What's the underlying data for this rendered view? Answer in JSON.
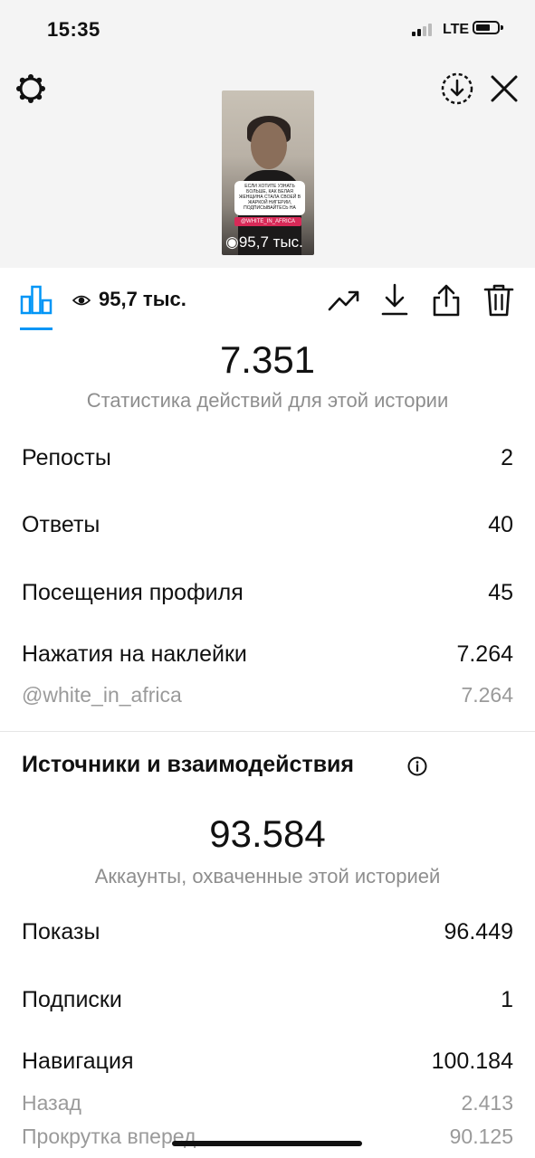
{
  "status_bar": {
    "time": "15:35",
    "network": "LTE"
  },
  "story_preview": {
    "caption": "ЕСЛИ ХОТИТЕ УЗНАТЬ БОЛЬШЕ, КАК БЕЛАЯ ЖЕНЩИНА СТАЛА СВОЕЙ В ЖАРКОЙ НИГЕРИИ, ПОДПИСЫВАЙТЕСЬ НА",
    "tag": "@WHITE_IN_AFRICA",
    "views": "95,7 тыс."
  },
  "toolbar": {
    "views": "95,7 тыс.",
    "icons": [
      "bar-chart-icon",
      "eye-icon",
      "trending-icon",
      "download-icon",
      "share-icon",
      "trash-icon"
    ]
  },
  "actions": {
    "total": "7.351",
    "subtitle": "Статистика действий для этой истории",
    "rows": [
      {
        "label": "Репосты",
        "value": "2"
      },
      {
        "label": "Ответы",
        "value": "40"
      },
      {
        "label": "Посещения профиля",
        "value": "45"
      },
      {
        "label": "Нажатия на наклейки",
        "value": "7.264"
      }
    ],
    "sticker": {
      "label": "@white_in_africa",
      "value": "7.264"
    }
  },
  "sources": {
    "title": "Источники и взаимодействия",
    "total": "93.584",
    "subtitle": "Аккаунты, охваченные этой историей",
    "rows": [
      {
        "label": "Показы",
        "value": "96.449"
      },
      {
        "label": "Подписки",
        "value": "1"
      },
      {
        "label": "Навигация",
        "value": "100.184"
      }
    ],
    "nav_sub": [
      {
        "label": "Назад",
        "value": "2.413"
      },
      {
        "label": "Прокрутка вперед",
        "value": "90.125"
      }
    ]
  }
}
